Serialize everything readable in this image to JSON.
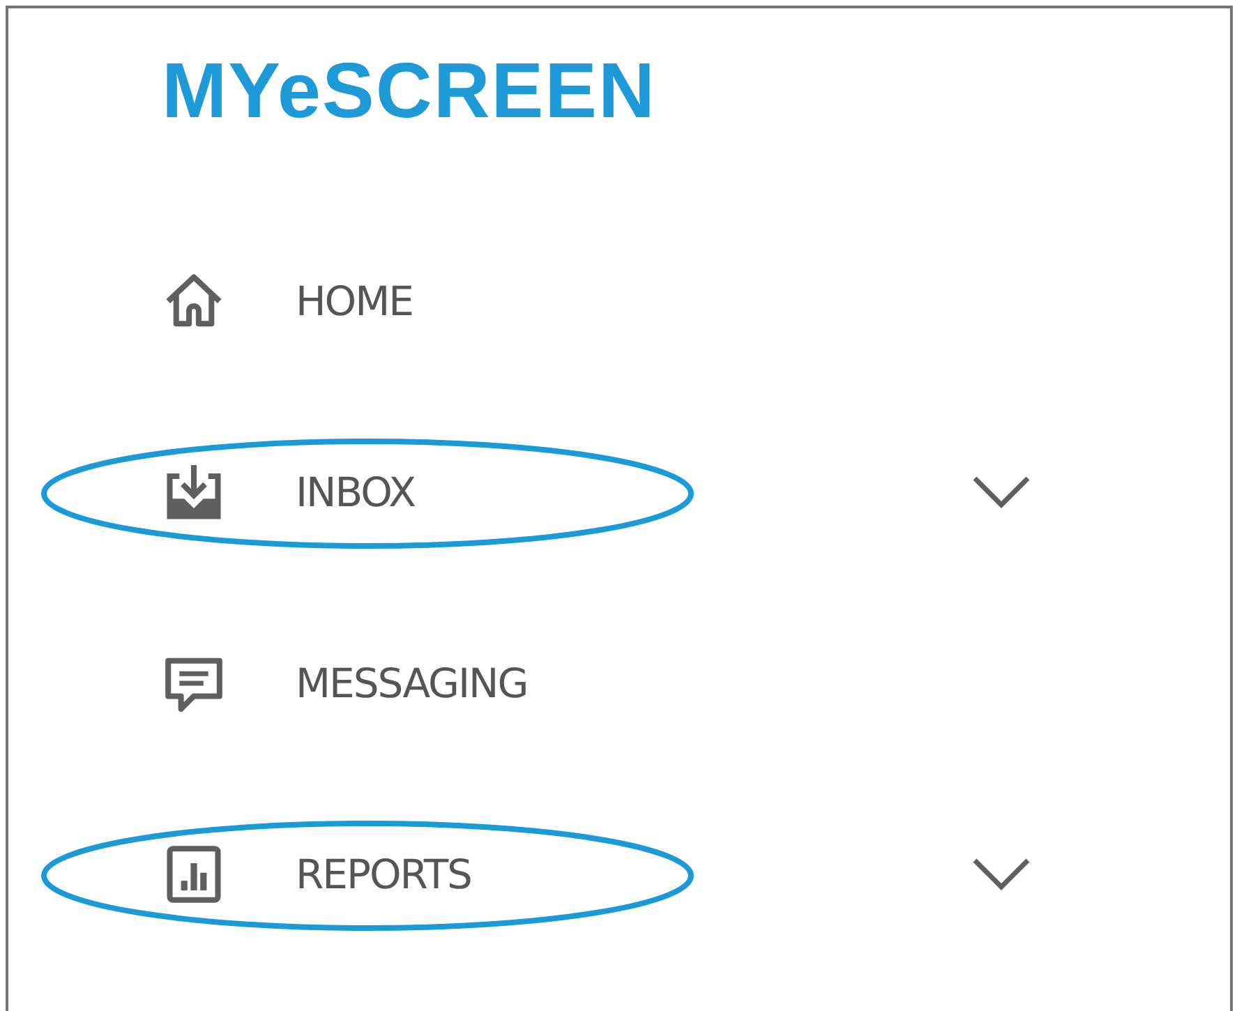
{
  "logo": "MYeSCREEN",
  "menu": [
    {
      "kind": "home",
      "label": "HOME",
      "has_submenu": false,
      "highlighted": false
    },
    {
      "kind": "inbox",
      "label": "INBOX",
      "has_submenu": true,
      "highlighted": true
    },
    {
      "kind": "messaging",
      "label": "MESSAGING",
      "has_submenu": false,
      "highlighted": false
    },
    {
      "kind": "reports",
      "label": "REPORTS",
      "has_submenu": true,
      "highlighted": true
    }
  ]
}
